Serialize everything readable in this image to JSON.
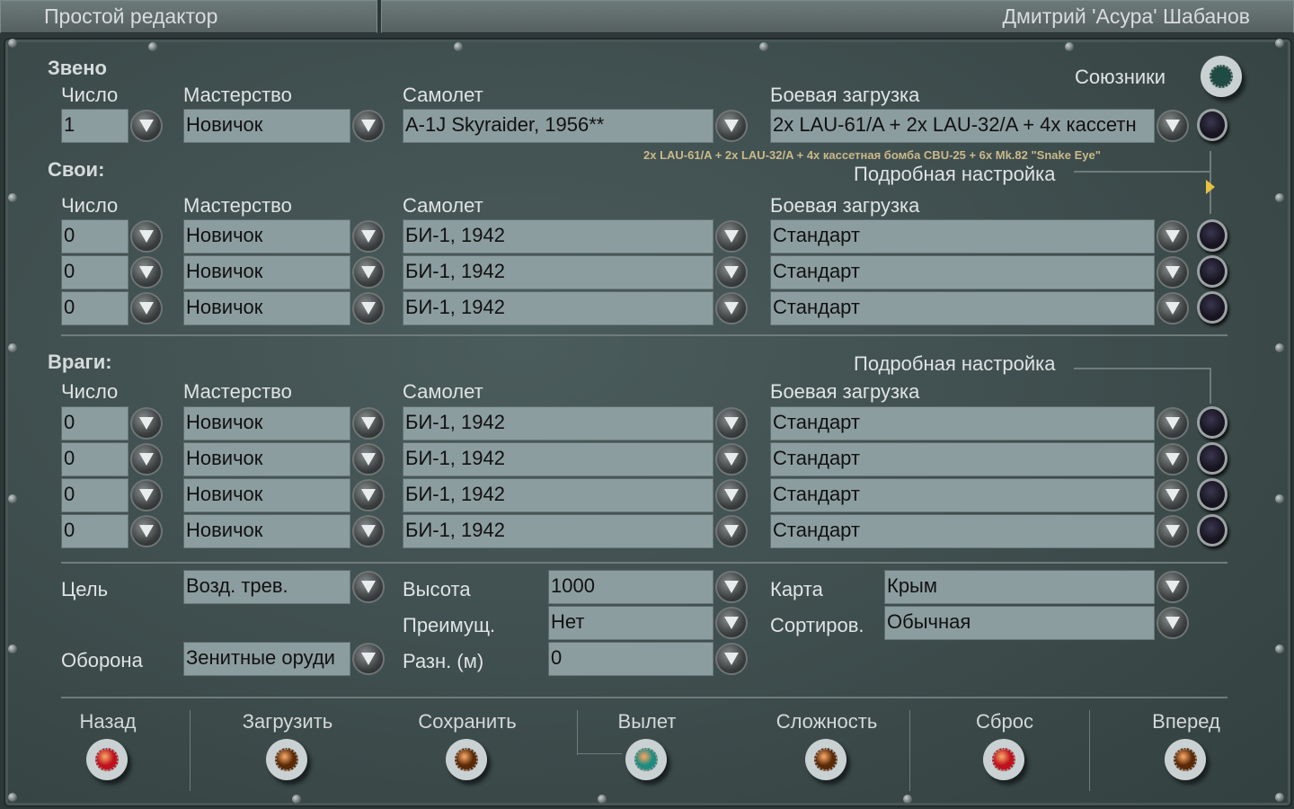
{
  "header": {
    "title": "Простой редактор",
    "user": "Дмитрий 'Асура' Шабанов"
  },
  "columns": {
    "count": "Число",
    "skill": "Мастерство",
    "plane": "Самолет",
    "loadout": "Боевая загрузка"
  },
  "flight": {
    "label": "Звено",
    "allies_label": "Союзники",
    "row": {
      "count": "1",
      "skill": "Новичок",
      "plane": "A-1J Skyraider, 1956**",
      "loadout": "2x LAU-61/A + 2x LAU-32/A + 4x кассетн"
    },
    "loadout_tooltip": "2x LAU-61/A + 2x LAU-32/A + 4x кассетная бомба CBU-25 + 6x Mk.82 \"Snake Eye\""
  },
  "friendly": {
    "label": "Свои:",
    "detail_label": "Подробная настройка",
    "rows": [
      {
        "count": "0",
        "skill": "Новичок",
        "plane": "БИ-1, 1942",
        "loadout": "Стандарт"
      },
      {
        "count": "0",
        "skill": "Новичок",
        "plane": "БИ-1, 1942",
        "loadout": "Стандарт"
      },
      {
        "count": "0",
        "skill": "Новичок",
        "plane": "БИ-1, 1942",
        "loadout": "Стандарт"
      }
    ]
  },
  "enemy": {
    "label": "Враги:",
    "detail_label": "Подробная настройка",
    "rows": [
      {
        "count": "0",
        "skill": "Новичок",
        "plane": "БИ-1, 1942",
        "loadout": "Стандарт"
      },
      {
        "count": "0",
        "skill": "Новичок",
        "plane": "БИ-1, 1942",
        "loadout": "Стандарт"
      },
      {
        "count": "0",
        "skill": "Новичок",
        "plane": "БИ-1, 1942",
        "loadout": "Стандарт"
      },
      {
        "count": "0",
        "skill": "Новичок",
        "plane": "БИ-1, 1942",
        "loadout": "Стандарт"
      }
    ]
  },
  "mission": {
    "target": {
      "label": "Цель",
      "value": "Возд. трев."
    },
    "defense": {
      "label": "Оборона",
      "value": "Зенитные оруди"
    },
    "altitude": {
      "label": "Высота",
      "value": "1000"
    },
    "advantage": {
      "label": "Преимущ.",
      "value": "Нет"
    },
    "diff": {
      "label": "Разн. (м)",
      "value": "0"
    },
    "map": {
      "label": "Карта",
      "value": "Крым"
    },
    "sort": {
      "label": "Сортиров.",
      "value": "Обычная"
    }
  },
  "buttons": [
    {
      "label": "Назад",
      "color": "#c0121e"
    },
    {
      "label": "Загрузить",
      "color": "#5a2a08"
    },
    {
      "label": "Сохранить",
      "color": "#5a2a08"
    },
    {
      "label": "Вылет",
      "color": "#1d8c80"
    },
    {
      "label": "Сложность",
      "color": "#5a2a08"
    },
    {
      "label": "Сброс",
      "color": "#c0121e"
    },
    {
      "label": "Вперед",
      "color": "#5a2a08"
    }
  ]
}
